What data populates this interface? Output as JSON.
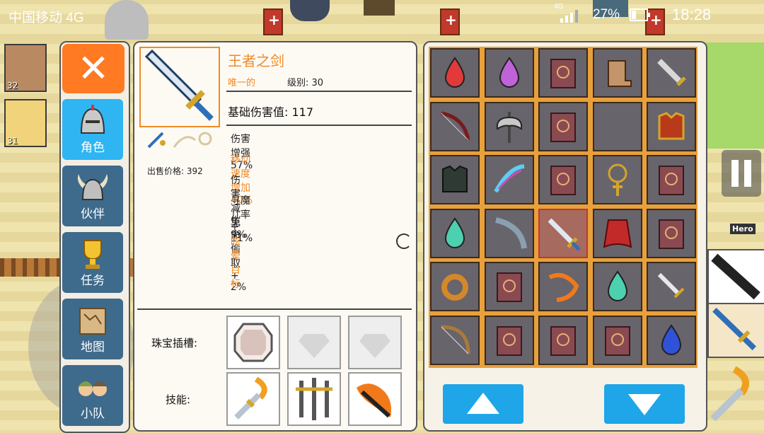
{
  "status_bar": {
    "carrier": "中国移动 4G",
    "battery": "27%",
    "time": "18:28",
    "network": "4G"
  },
  "party": [
    {
      "level": "32"
    },
    {
      "level": "31"
    }
  ],
  "menu": {
    "tabs": [
      {
        "label": "角色",
        "icon": "knight-helmet-icon",
        "active": true
      },
      {
        "label": "伙伴",
        "icon": "horned-helmet-icon",
        "active": false
      },
      {
        "label": "任务",
        "icon": "trophy-icon",
        "active": false
      },
      {
        "label": "地图",
        "icon": "map-scroll-icon",
        "active": false
      },
      {
        "label": "小队",
        "icon": "party-faces-icon",
        "active": false
      }
    ]
  },
  "item": {
    "name": "王者之剑",
    "rarity": "唯一的",
    "level": "级别: 30",
    "base_damage": "基础伤害值: 117",
    "sell_price": "出售价格: 392",
    "stats": [
      {
        "text": "伤害增强 57%",
        "color": "#222222"
      },
      {
        "text": "移动速度增加 40%",
        "color": "#f08a24"
      },
      {
        "text": "伤害减免 9%",
        "color": "#222222"
      },
      {
        "text": "寻魔几率 + 11%",
        "color": "#222222"
      },
      {
        "text": "生命偷取 + 2%",
        "color": "#222222"
      },
      {
        "text": "眩晕目标",
        "color": "#f08a24"
      }
    ]
  },
  "gems": {
    "label": "珠宝插槽:",
    "slots": [
      "white-gem",
      "empty",
      "empty"
    ]
  },
  "skills": {
    "label": "技能:",
    "slots": [
      "sword-slash-skill",
      "triple-sword-skill",
      "fire-sword-skill"
    ]
  },
  "inventory": [
    [
      "red-gem",
      "purple-gem",
      "spellbook",
      "fur-boots",
      "short-sword"
    ],
    [
      "recurve-bow",
      "battle-axe",
      "spellbook",
      "empty",
      "gold-chest-armor"
    ],
    [
      "dark-armor",
      "feather-charm",
      "spellbook",
      "cross-amulet",
      "spellbook"
    ],
    [
      "teal-gem",
      "curved-blade",
      "blue-sword",
      "red-cape",
      "spellbook"
    ],
    [
      "gold-ring",
      "spellbook",
      "fire-bow",
      "teal-gem",
      "dagger"
    ],
    [
      "longbow",
      "spellbook",
      "spellbook",
      "spellbook",
      "blue-gem"
    ]
  ],
  "selected_cell": [
    3,
    2
  ],
  "hero_tag": "Hero",
  "colors": {
    "accent": "#f08a24",
    "tab_active": "#2fb5f2",
    "tab_inactive": "#3e6a8c",
    "arrow_button": "#1ea6e8",
    "grid_border": "#e8a03c"
  }
}
